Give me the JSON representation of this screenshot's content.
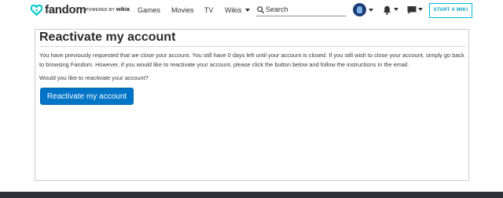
{
  "brand": {
    "name": "fandom",
    "powered_by": "POWERED BY",
    "powered_brand": "wikia",
    "logo_color": "#00d6d6"
  },
  "nav": {
    "items": [
      "Games",
      "Movies",
      "TV",
      "Wikis"
    ],
    "wikis_has_dropdown": true
  },
  "search": {
    "placeholder": "Search",
    "icon": "search-icon"
  },
  "user": {
    "avatar_icon": "avatar",
    "notifications_icon": "bell-icon",
    "messages_icon": "chat-bubble-icon"
  },
  "start_wiki": {
    "label": "START A WIKI",
    "color": "#00b7e0"
  },
  "page": {
    "title": "Reactivate my account",
    "message": "You have previously requested that we close your account. You still have 0 days left until your account is closed. If you still wish to close your account, simply go back to browsing Fandom. However, if you would like to reactivate your account, please click the button below and follow the instructions in the email.",
    "question": "Would you like to reactivate your account?",
    "button_label": "Reactivate my account",
    "button_color": "#0075c8"
  },
  "footer": {
    "color": "#2e3138"
  }
}
